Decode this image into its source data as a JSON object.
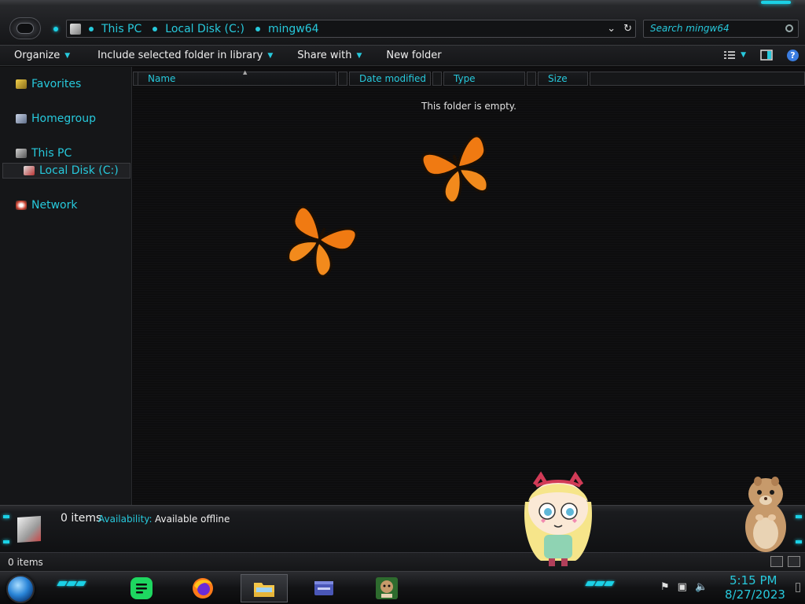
{
  "window": {
    "breadcrumbs": [
      "This PC",
      "Local Disk (C:)",
      "mingw64"
    ],
    "search_placeholder": "Search mingw64"
  },
  "toolbar": {
    "organize": "Organize",
    "include_library": "Include selected folder in library",
    "share_with": "Share with",
    "new_folder": "New folder"
  },
  "nav": {
    "favorites": "Favorites",
    "homegroup": "Homegroup",
    "this_pc": "This PC",
    "local_disk": "Local Disk (C:)",
    "network": "Network"
  },
  "columns": [
    "Name",
    "Date modified",
    "Type",
    "Size"
  ],
  "content": {
    "empty_message": "This folder is empty."
  },
  "details": {
    "item_count": "0 items",
    "availability_label": "Availability:",
    "availability_value": "Available offline"
  },
  "status": {
    "item_count": "0 items"
  },
  "clock": {
    "time": "5:15 PM",
    "date": "8/27/2023"
  },
  "colors": {
    "accent": "#27c9dc",
    "background": "#0b0b0c"
  }
}
